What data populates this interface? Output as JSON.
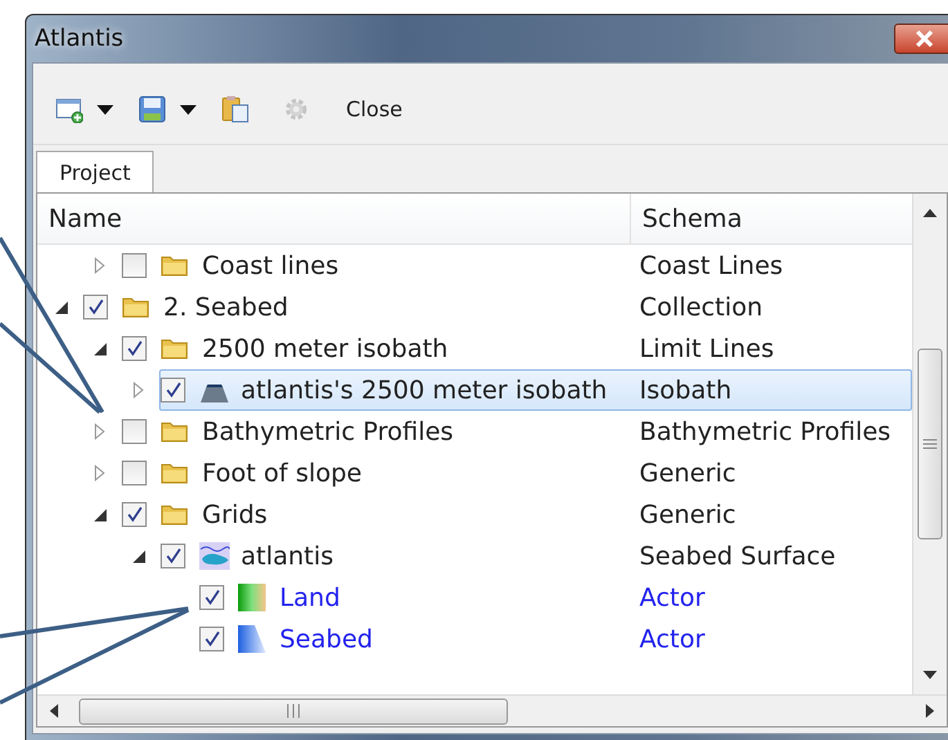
{
  "window": {
    "title": "Atlantis"
  },
  "toolbar": [
    {
      "kind": "new",
      "dropdown": true,
      "disabled": false
    },
    {
      "kind": "save",
      "dropdown": true,
      "disabled": false
    },
    {
      "kind": "paste",
      "dropdown": false,
      "disabled": false
    },
    {
      "kind": "settings",
      "dropdown": false,
      "disabled": true
    },
    {
      "kind": "text",
      "label": "Close",
      "dropdown": false,
      "disabled": false
    }
  ],
  "tabs": [
    {
      "label": "Project",
      "selected": true
    }
  ],
  "tree": {
    "columns": [
      "Name",
      "Schema"
    ],
    "continued_children": [
      {
        "label": "Coast lines",
        "schema": "Coast Lines",
        "kind": "folder",
        "expanded": false,
        "checked": false,
        "selected": false,
        "highlighted": false
      }
    ],
    "items": [
      {
        "label": "2. Seabed",
        "schema": "Collection",
        "kind": "folder",
        "expanded": true,
        "checked": true,
        "selected": false,
        "highlighted": false,
        "children": [
          {
            "label": "2500 meter isobath",
            "schema": "Limit Lines",
            "kind": "folder",
            "expanded": true,
            "checked": true,
            "selected": false,
            "highlighted": false,
            "children": [
              {
                "label": "atlantis's 2500 meter isobath",
                "schema": "Isobath",
                "kind": "isobath",
                "expanded": false,
                "checked": true,
                "selected": true,
                "highlighted": false
              }
            ]
          },
          {
            "label": "Bathymetric Profiles",
            "schema": "Bathymetric Profiles",
            "kind": "folder",
            "expanded": false,
            "checked": false,
            "selected": false,
            "highlighted": false
          },
          {
            "label": "Foot of slope",
            "schema": "Generic",
            "kind": "folder",
            "expanded": false,
            "checked": false,
            "selected": false,
            "highlighted": false
          },
          {
            "label": "Grids",
            "schema": "Generic",
            "kind": "folder",
            "expanded": true,
            "checked": true,
            "selected": false,
            "highlighted": false,
            "children": [
              {
                "label": "atlantis",
                "schema": "Seabed Surface",
                "kind": "surface",
                "expanded": true,
                "checked": true,
                "selected": false,
                "highlighted": false,
                "children": [
                  {
                    "label": "Land",
                    "schema": "Actor",
                    "kind": "land",
                    "checked": true,
                    "selected": false,
                    "highlighted": true
                  },
                  {
                    "label": "Seabed",
                    "schema": "Actor",
                    "kind": "seabed",
                    "checked": true,
                    "selected": false,
                    "highlighted": true
                  }
                ]
              }
            ]
          }
        ]
      }
    ]
  }
}
